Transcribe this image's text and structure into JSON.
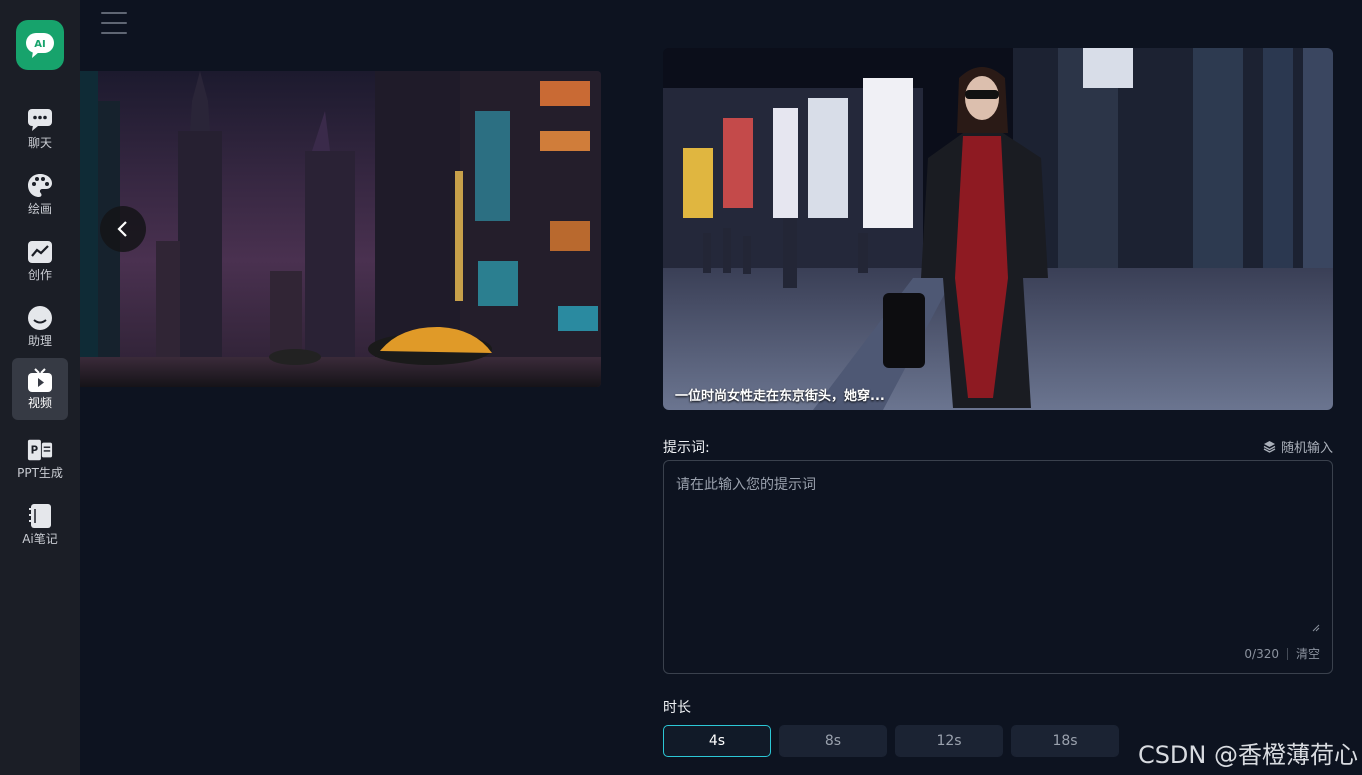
{
  "sidebar": {
    "logo_text": "AI",
    "items": [
      {
        "label": "聊天",
        "icon": "chat-icon"
      },
      {
        "label": "绘画",
        "icon": "palette-icon"
      },
      {
        "label": "创作",
        "icon": "chart-icon"
      },
      {
        "label": "助理",
        "icon": "assistant-icon"
      },
      {
        "label": "视频",
        "icon": "video-icon",
        "active": true
      },
      {
        "label": "PPT生成",
        "icon": "ppt-icon"
      },
      {
        "label": "Ai笔记",
        "icon": "notebook-icon"
      }
    ]
  },
  "header": {
    "menu_icon": "hamburger-icon"
  },
  "preview": {
    "caption": "一位时尚女性走在东京街头，她穿..."
  },
  "prompt": {
    "label": "提示词:",
    "random_label": "随机输入",
    "placeholder": "请在此输入您的提示词",
    "value": "",
    "counter": "0/320",
    "clear_label": "清空"
  },
  "duration": {
    "label": "时长",
    "options": [
      "4s",
      "8s",
      "12s",
      "18s"
    ],
    "selected": "4s"
  },
  "watermark": "CSDN @香橙薄荷心",
  "colors": {
    "accent": "#2cc7d6",
    "brand": "#17a36c",
    "sidebar_bg": "#1b1e26",
    "page_bg": "#0d1320"
  }
}
